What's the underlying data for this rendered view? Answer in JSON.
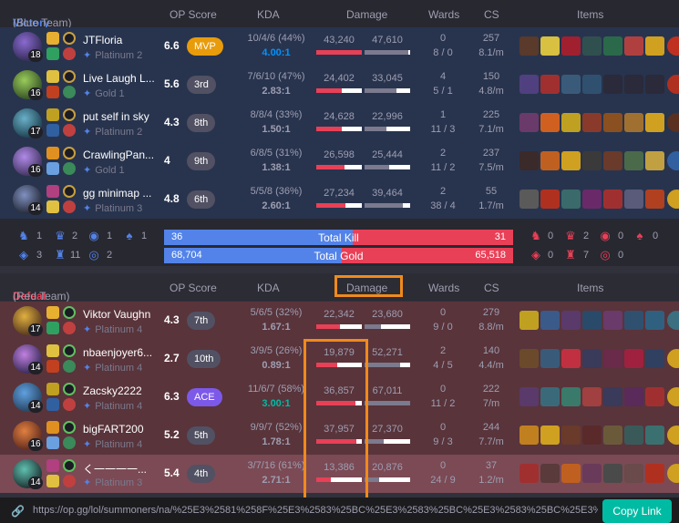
{
  "colors": {
    "blue_team": "#5383e8",
    "red_team": "#e84057",
    "damage_bar_dealt": "#e84057",
    "damage_bar_taken": "#7b7a8e",
    "mvp": "#e89c0c",
    "ace": "#7d59ea",
    "highlight": "#f08a1c",
    "accent": "#00bba3"
  },
  "blue": {
    "header": {
      "result": "Victory",
      "team": "(Blue Team)",
      "op_score": "OP Score",
      "kda": "KDA",
      "damage": "Damage",
      "wards": "Wards",
      "cs": "CS",
      "items": "Items"
    },
    "players": [
      {
        "name": "JTFloria",
        "tier": "Platinum 2",
        "level": "18",
        "score": "6.6",
        "badge": "MVP",
        "kda": "10/4/6 (44%)",
        "ratio": "4.00:1",
        "dealt": "43,240",
        "taken": "47,610",
        "dealt_frac": 1.0,
        "taken_frac": 0.95,
        "wards": "0",
        "wards2": "8 / 0",
        "cs": "257",
        "cspm": "8.1/m"
      },
      {
        "name": "Live Laugh L...",
        "tier": "Gold 1",
        "level": "16",
        "score": "5.6",
        "badge": "3rd",
        "kda": "7/6/10 (47%)",
        "ratio": "2.83:1",
        "dealt": "24,402",
        "taken": "33,045",
        "dealt_frac": 0.56,
        "taken_frac": 0.69,
        "wards": "4",
        "wards2": "5 / 1",
        "cs": "150",
        "cspm": "4.8/m"
      },
      {
        "name": "put self in sky",
        "tier": "Platinum 2",
        "level": "17",
        "score": "4.3",
        "badge": "8th",
        "kda": "8/8/4 (33%)",
        "ratio": "1.50:1",
        "dealt": "24,628",
        "taken": "22,996",
        "dealt_frac": 0.57,
        "taken_frac": 0.48,
        "wards": "1",
        "wards2": "11 / 3",
        "cs": "225",
        "cspm": "7.1/m"
      },
      {
        "name": "CrawlingPan...",
        "tier": "Gold 1",
        "level": "16",
        "score": "4",
        "badge": "9th",
        "kda": "6/8/5 (31%)",
        "ratio": "1.38:1",
        "dealt": "26,598",
        "taken": "25,444",
        "dealt_frac": 0.61,
        "taken_frac": 0.53,
        "wards": "2",
        "wards2": "11 / 2",
        "cs": "237",
        "cspm": "7.5/m"
      },
      {
        "name": "gg minimap ...",
        "tier": "Platinum 3",
        "level": "14",
        "score": "4.8",
        "badge": "6th",
        "kda": "5/5/8 (36%)",
        "ratio": "2.60:1",
        "dealt": "27,234",
        "taken": "39,464",
        "dealt_frac": 0.63,
        "taken_frac": 0.83,
        "wards": "2",
        "wards2": "38 / 4",
        "cs": "55",
        "cspm": "1.7/m"
      }
    ]
  },
  "totals": {
    "blue_objectives": [
      "1",
      "2",
      "1",
      "1",
      "3",
      "11",
      "2"
    ],
    "red_objectives": [
      "0",
      "2",
      "0",
      "0",
      "0",
      "7",
      "0"
    ],
    "kills_blue": "36",
    "kills_label": "Total Kill",
    "kills_red": "31",
    "kills_blue_frac": 0.54,
    "gold_blue": "68,704",
    "gold_label": "Total Gold",
    "gold_red": "65,518",
    "gold_blue_frac": 0.51
  },
  "red": {
    "header": {
      "result": "Defeat",
      "team": "(Red Team)",
      "op_score": "OP Score",
      "kda": "KDA",
      "damage": "Damage",
      "wards": "Wards",
      "cs": "CS",
      "items": "Items"
    },
    "players": [
      {
        "name": "Viktor Vaughn",
        "tier": "Platinum 4",
        "level": "17",
        "score": "4.3",
        "badge": "7th",
        "kda": "5/6/5 (32%)",
        "ratio": "1.67:1",
        "dealt": "22,342",
        "taken": "23,680",
        "dealt_frac": 0.52,
        "taken_frac": 0.35,
        "wards": "0",
        "wards2": "9 / 0",
        "cs": "279",
        "cspm": "8.8/m"
      },
      {
        "name": "nbaenjoyer6...",
        "tier": "Platinum 4",
        "level": "14",
        "score": "2.7",
        "badge": "10th",
        "kda": "3/9/5 (26%)",
        "ratio": "0.89:1",
        "dealt": "19,879",
        "taken": "52,271",
        "dealt_frac": 0.46,
        "taken_frac": 0.78,
        "wards": "2",
        "wards2": "4 / 5",
        "cs": "140",
        "cspm": "4.4/m"
      },
      {
        "name": "Zacsky2222",
        "tier": "Platinum 4",
        "level": "14",
        "score": "6.3",
        "badge": "ACE",
        "kda": "11/6/7 (58%)",
        "ratio": "3.00:1",
        "dealt": "36,857",
        "taken": "67,011",
        "dealt_frac": 0.85,
        "taken_frac": 1.0,
        "wards": "0",
        "wards2": "11 / 2",
        "cs": "222",
        "cspm": "7/m"
      },
      {
        "name": "bigFART200",
        "tier": "Platinum 4",
        "level": "16",
        "score": "5.2",
        "badge": "5th",
        "kda": "9/9/7 (52%)",
        "ratio": "1.78:1",
        "dealt": "37,957",
        "taken": "27,370",
        "dealt_frac": 0.88,
        "taken_frac": 0.41,
        "wards": "0",
        "wards2": "9 / 3",
        "cs": "244",
        "cspm": "7.7/m"
      },
      {
        "name": "く一一一一...",
        "tier": "Platinum 3",
        "level": "14",
        "score": "5.4",
        "badge": "4th",
        "kda": "3/7/16 (61%)",
        "ratio": "2.71:1",
        "dealt": "13,386",
        "taken": "20,876",
        "dealt_frac": 0.31,
        "taken_frac": 0.31,
        "wards": "0",
        "wards2": "24 / 9",
        "cs": "37",
        "cspm": "1.2/m"
      }
    ]
  },
  "footer": {
    "url": "https://op.gg/lol/summoners/na/%25E3%2581%258F%25E3%2583%25BC%25E3%2583%25BC%25E3%2583%25BC%25E3%...",
    "copy_label": "Copy Link"
  }
}
